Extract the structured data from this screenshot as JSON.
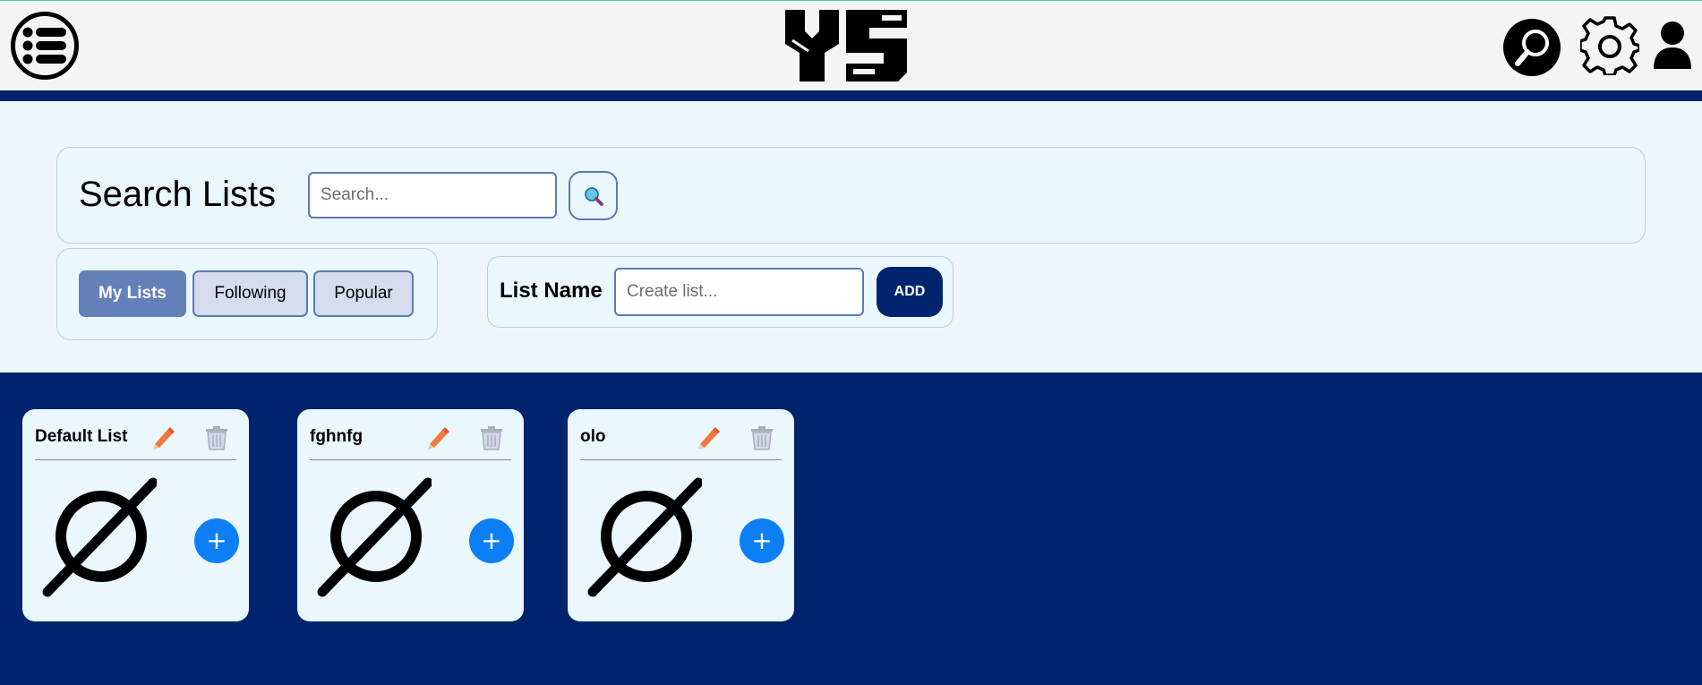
{
  "header": {
    "menu_icon": "list-menu-icon",
    "logo_icon": "ys-logo",
    "search_icon": "search-icon",
    "settings_icon": "gear-icon",
    "profile_icon": "user-icon"
  },
  "search": {
    "title": "Search Lists",
    "placeholder": "Search...",
    "button_icon": "search-icon"
  },
  "tabs": [
    {
      "label": "My Lists",
      "active": true
    },
    {
      "label": "Following",
      "active": false
    },
    {
      "label": "Popular",
      "active": false
    }
  ],
  "create": {
    "label": "List Name",
    "placeholder": "Create list...",
    "button": "ADD"
  },
  "cards": [
    {
      "title": "Default List",
      "edit_icon": "pencil-icon",
      "delete_icon": "trash-icon",
      "empty_icon": "empty-set-icon",
      "add_label": "+"
    },
    {
      "title": "fghnfg",
      "edit_icon": "pencil-icon",
      "delete_icon": "trash-icon",
      "empty_icon": "empty-set-icon",
      "add_label": "+"
    },
    {
      "title": "olo",
      "edit_icon": "pencil-icon",
      "delete_icon": "trash-icon",
      "empty_icon": "empty-set-icon",
      "add_label": "+"
    }
  ],
  "colors": {
    "brand_navy": "#00256e",
    "tab_active": "#6381b8",
    "add_blue": "#0d7ff5"
  }
}
